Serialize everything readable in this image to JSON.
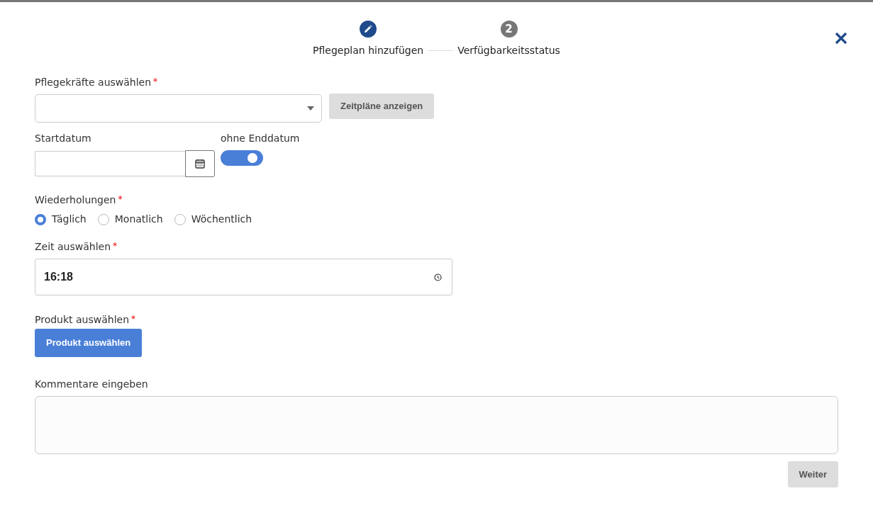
{
  "stepper": {
    "steps": [
      {
        "kind": "edit",
        "label": "Pflegeplan hinzufügen",
        "active": true
      },
      {
        "kind": "number",
        "number": "2",
        "label": "Verfügbarkeitsstatus",
        "active": false
      }
    ]
  },
  "form": {
    "caregivers": {
      "label": "Pflegekräfte auswählen",
      "required_mark": "*",
      "button": "Zeitpläne anzeigen"
    },
    "start_date": {
      "label": "Startdatum"
    },
    "no_end_date": {
      "label": "ohne Enddatum",
      "on": true
    },
    "repetitions": {
      "label": "Wiederholungen",
      "required_mark": "*",
      "options": [
        {
          "label": "Täglich",
          "selected": true
        },
        {
          "label": "Monatlich",
          "selected": false
        },
        {
          "label": "Wöchentlich",
          "selected": false
        }
      ]
    },
    "time": {
      "label": "Zeit auswählen",
      "required_mark": "*",
      "value": "16:18"
    },
    "product": {
      "label": "Produkt auswählen",
      "required_mark": "*",
      "button": "Produkt auswählen"
    },
    "comments": {
      "label": "Kommentare eingeben"
    }
  },
  "footer": {
    "button": "Weiter"
  }
}
